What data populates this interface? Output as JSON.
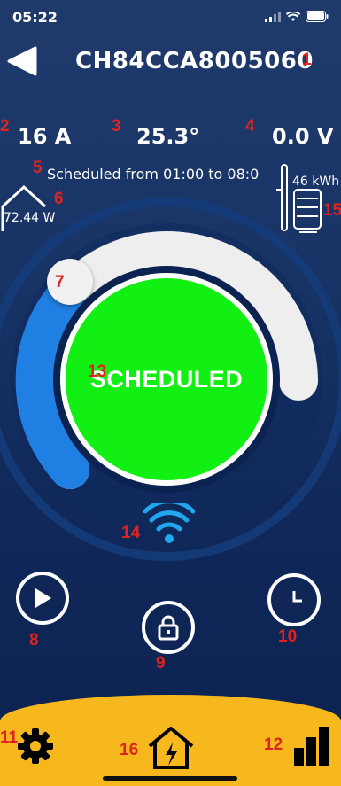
{
  "status_bar": {
    "time": "05:22"
  },
  "header": {
    "title": "CH84CCA8005060",
    "title_marker": "1"
  },
  "metrics": {
    "current": {
      "marker": "2",
      "value": "16 A"
    },
    "temperature": {
      "marker": "3",
      "value": "25.3°"
    },
    "voltage": {
      "marker": "4",
      "value": "0.0 V"
    }
  },
  "schedule": {
    "marker": "5",
    "text": "Scheduled from 01:00 to 08:0"
  },
  "house": {
    "marker": "6",
    "power": "72.44 W"
  },
  "battery": {
    "marker": "15",
    "energy": "46 kWh"
  },
  "knob": {
    "marker": "7"
  },
  "main_circle": {
    "marker": "13",
    "label": "SCHEDULED",
    "color": "#12ef12"
  },
  "wifi": {
    "marker": "14"
  },
  "controls": {
    "play": {
      "marker": "8"
    },
    "lock": {
      "marker": "9"
    },
    "timer": {
      "marker": "10"
    }
  },
  "bottom_nav": {
    "settings_marker": "11",
    "home_marker": "16",
    "stats_marker": "12",
    "color": "#f7b81e"
  },
  "colors": {
    "accent_blue": "#1f7fe3",
    "ring_track": "#eeeeee",
    "wifi_blue": "#1fa7f0"
  }
}
